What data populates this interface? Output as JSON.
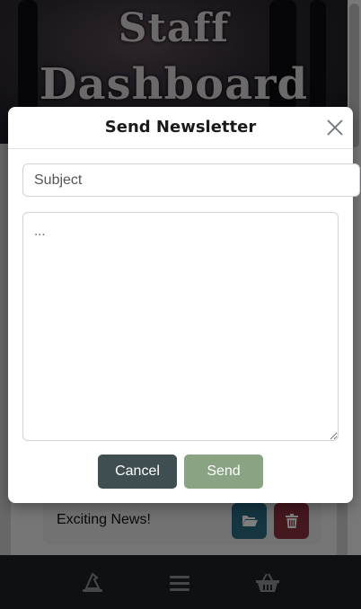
{
  "hero": {
    "title_line1": "Staff",
    "title_line2": "Dashboard"
  },
  "newsletter_list": {
    "items": [
      {
        "title": "Exciting News!"
      }
    ]
  },
  "modal": {
    "title": "Send Newsletter",
    "subject_placeholder": "Subject",
    "message_placeholder": "...",
    "cancel_label": "Cancel",
    "send_label": "Send"
  },
  "icons": {
    "close": "close-icon",
    "open": "folder-open-icon",
    "delete": "trash-icon",
    "nav_home": "wizard-hat-icon",
    "nav_menu": "menu-icon",
    "nav_basket": "basket-icon"
  },
  "colors": {
    "cancel_button": "#3f4e50",
    "send_button": "#8aa382",
    "open_button": "#2b6a82",
    "delete_button": "#8a2e3f",
    "bottom_nav": "#1d2126"
  }
}
